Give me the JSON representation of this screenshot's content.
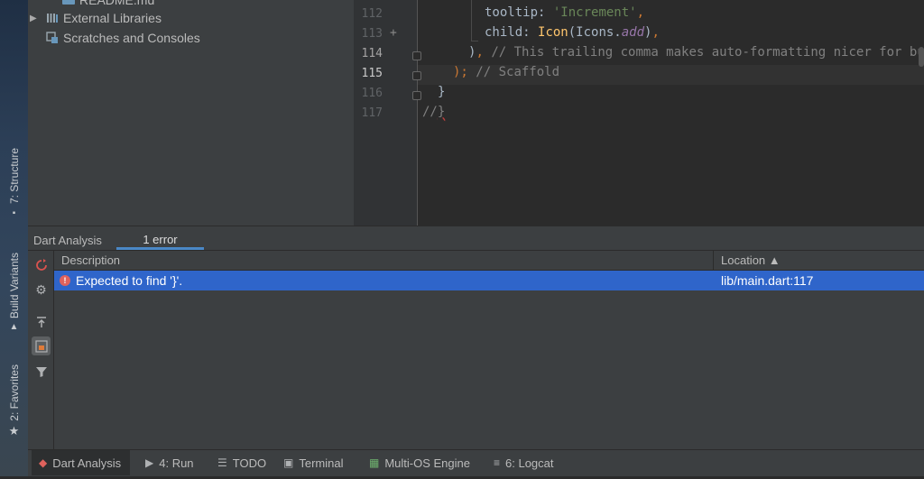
{
  "left_strip": {
    "structure_label": "7: Structure",
    "build_variants_label": "Build Variants",
    "favorites_label": "2: Favorites"
  },
  "project_tree": {
    "items": [
      {
        "label": "README.md"
      },
      {
        "label": "External Libraries"
      },
      {
        "label": "Scratches and Consoles"
      }
    ]
  },
  "editor": {
    "lines": [
      {
        "num": "112"
      },
      {
        "num": "113"
      },
      {
        "num": "114"
      },
      {
        "num": "115"
      },
      {
        "num": "116"
      },
      {
        "num": "117"
      }
    ],
    "tooltip_key": "tooltip:",
    "tooltip_value": "'Increment'",
    "child_key": "child:",
    "icon_class": "Icon",
    "icons_ref": "(Icons.",
    "icons_add": "add",
    "close_paren": ")",
    "comma": ",",
    "comment_114": "// This trailing comma makes auto-formatting nicer for bu",
    "line115_paren": ");",
    "comment_115": "// Scaffold",
    "line116": "}",
    "line117_slashes": "//",
    "line117_brace": "}"
  },
  "tool_window": {
    "title": "Dart Analysis",
    "tab_label": "1 error",
    "columns": {
      "description": "Description",
      "location": "Location ▲"
    },
    "rows": [
      {
        "description": "Expected to find '}'.",
        "location": "lib/main.dart:117"
      }
    ]
  },
  "bottom_bar": {
    "tabs": [
      {
        "label": "Dart Analysis"
      },
      {
        "label": "4: Run"
      },
      {
        "label": "TODO"
      },
      {
        "label": "Terminal"
      },
      {
        "label": "Multi-OS Engine"
      },
      {
        "label": "6: Logcat"
      }
    ]
  },
  "colors": {
    "selection": "#2f65ca",
    "accent": "#4a88c7",
    "error": "#e0625c"
  }
}
